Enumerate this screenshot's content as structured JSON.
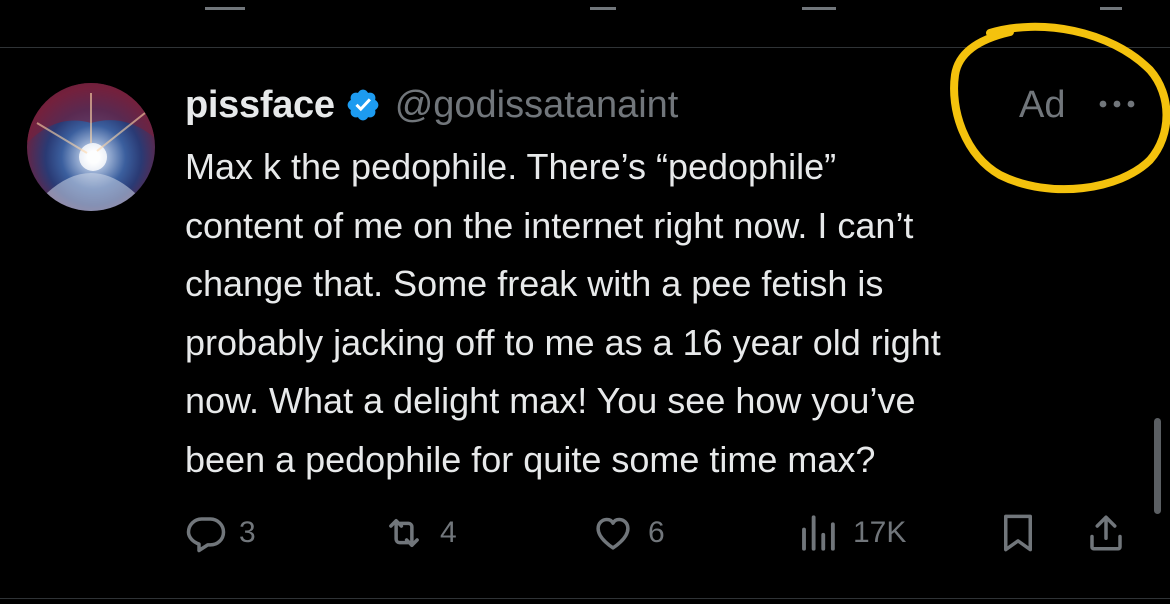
{
  "tweet": {
    "author": {
      "display_name": "pissface",
      "handle": "@godissatanaint",
      "verified": true,
      "avatar": "avatar-image"
    },
    "ad_label": "Ad",
    "more_icon": "more-icon",
    "text": "Max k the pedophile. There’s “pedophile”\ncontent of me on the internet right now. I can’t\nchange that. Some freak with a pee fetish is\nprobably jacking off to me as a 16 year old right\nnow. What a delight max! You see how you’ve\nbeen a pedophile for quite some time max?",
    "actions": {
      "replies": "3",
      "reposts": "4",
      "likes": "6",
      "views": "17K"
    }
  },
  "icons": [
    "reply-icon",
    "repost-icon",
    "like-icon",
    "views-icon",
    "bookmark-icon",
    "share-icon",
    "verified-icon"
  ],
  "colors": {
    "background": "#000000",
    "text_primary": "#e7e9ea",
    "text_secondary": "#71767b",
    "verified_blue": "#1d9bf0",
    "annotation_yellow": "#f4c20d"
  }
}
